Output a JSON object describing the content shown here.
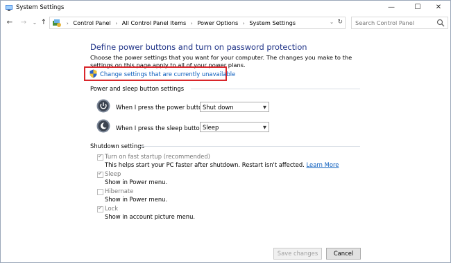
{
  "window": {
    "title": "System Settings",
    "minimize": "—",
    "maximize": "☐",
    "close": "✕"
  },
  "nav": {
    "back": "←",
    "forward": "→",
    "recent": "⌄",
    "up": "↑",
    "breadcrumbs": [
      "Control Panel",
      "All Control Panel Items",
      "Power Options",
      "System Settings"
    ],
    "separator": "›",
    "dropdown": "⌄",
    "refresh": "↻",
    "search_placeholder": "Search Control Panel"
  },
  "main": {
    "heading": "Define power buttons and turn on password protection",
    "description": "Choose the power settings that you want for your computer. The changes you make to the settings on this page apply to all of your power plans.",
    "change_link": "Change settings that are currently unavailable"
  },
  "power_section": {
    "title": "Power and sleep button settings",
    "rows": [
      {
        "label": "When I press the power button:",
        "value": "Shut down"
      },
      {
        "label": "When I press the sleep button:",
        "value": "Sleep"
      }
    ]
  },
  "shutdown_section": {
    "title": "Shutdown settings",
    "options": [
      {
        "title": "Turn on fast startup (recommended)",
        "desc": "This helps start your PC faster after shutdown. Restart isn't affected. ",
        "link": "Learn More",
        "checked": true
      },
      {
        "title": "Sleep",
        "desc": "Show in Power menu.",
        "checked": true
      },
      {
        "title": "Hibernate",
        "desc": "Show in Power menu.",
        "checked": false
      },
      {
        "title": "Lock",
        "desc": "Show in account picture menu.",
        "checked": true
      }
    ]
  },
  "buttons": {
    "save": "Save changes",
    "cancel": "Cancel"
  },
  "colors": {
    "heading": "#1e3287",
    "link": "#0b5dbd",
    "highlight_border": "#d9262b"
  }
}
